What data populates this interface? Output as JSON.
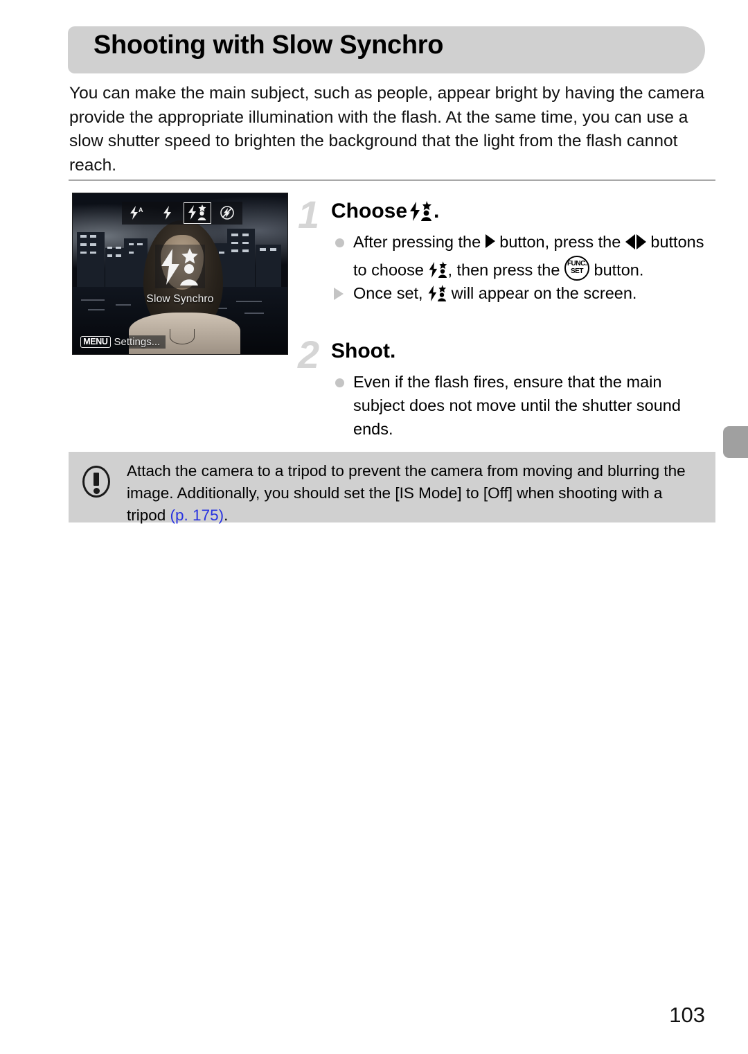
{
  "page": {
    "number": "103",
    "title": "Shooting with Slow Synchro",
    "intro": "You can make the main subject, such as people, appear bright by having the camera provide the appropriate illumination with the flash. At the same time, you can use a slow shutter speed to brighten the background that the light from the flash cannot reach."
  },
  "figure": {
    "mode_label": "Slow Synchro",
    "menu_chip": "MENU",
    "menu_text": "Settings...",
    "flash_icons": [
      {
        "name": "flash-auto-icon",
        "selected": false
      },
      {
        "name": "flash-on-icon",
        "selected": false
      },
      {
        "name": "slow-synchro-icon",
        "selected": true
      },
      {
        "name": "flash-off-icon",
        "selected": false
      }
    ]
  },
  "steps": [
    {
      "number": "1",
      "heading_prefix": "Choose",
      "heading_suffix": ".",
      "heading_icon": "slow-synchro-icon",
      "bullets": [
        {
          "type": "dot",
          "segments": [
            {
              "kind": "text",
              "value": "After pressing the "
            },
            {
              "kind": "icon",
              "value": "arrow-right-icon"
            },
            {
              "kind": "text",
              "value": " button, press the "
            },
            {
              "kind": "icon",
              "value": "arrow-left-right-icon"
            },
            {
              "kind": "text",
              "value": " buttons to choose "
            },
            {
              "kind": "icon",
              "value": "slow-synchro-icon"
            },
            {
              "kind": "text",
              "value": ", then press the "
            },
            {
              "kind": "icon",
              "value": "func-set-button-icon"
            },
            {
              "kind": "text",
              "value": " button."
            }
          ]
        },
        {
          "type": "triangle",
          "segments": [
            {
              "kind": "text",
              "value": "Once set, "
            },
            {
              "kind": "icon",
              "value": "slow-synchro-icon"
            },
            {
              "kind": "text",
              "value": " will appear on the screen."
            }
          ]
        }
      ]
    },
    {
      "number": "2",
      "heading_prefix": "Shoot.",
      "heading_suffix": "",
      "heading_icon": "",
      "bullets": [
        {
          "type": "dot",
          "segments": [
            {
              "kind": "text",
              "value": "Even if the flash fires, ensure that the main subject does not move until the shutter sound ends."
            }
          ]
        }
      ]
    }
  ],
  "caution": {
    "icon": "exclamation-circle-icon",
    "text_before_link": "Attach the camera to a tripod to prevent the camera from moving and blurring the image. Additionally, you should set the [IS Mode] to [Off] when shooting with a tripod ",
    "link_text": "(p. 175)",
    "text_after_link": "."
  },
  "func_button": {
    "line1": "FUNC.",
    "line2": "SET"
  },
  "colors": {
    "banner_gray": "#d0d0d0",
    "caution_gray": "#d0d0d0",
    "step_number_gray": "#d5d5d5",
    "bullet_gray": "#c4c4c4",
    "link_blue": "#2933e0",
    "edge_tab_gray": "#a0a0a0"
  }
}
